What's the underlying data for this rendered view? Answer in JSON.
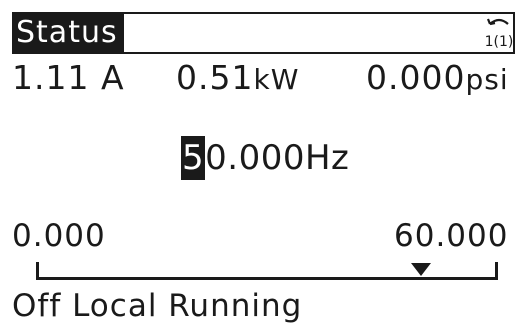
{
  "header": {
    "title": "Status",
    "icon": "menu-index-icon",
    "icon_text": "1(1)"
  },
  "readouts": [
    {
      "value": "1.11",
      "unit": "A"
    },
    {
      "value": "0.51",
      "unit": "kW"
    },
    {
      "value": "0.000",
      "unit": "psi"
    }
  ],
  "setpoint": {
    "cursor_digit": "5",
    "rest": "0.000",
    "unit": "Hz"
  },
  "range": {
    "min": "0.000",
    "max": "60.000",
    "current_fraction": 0.833
  },
  "status_line": "Off Local Running",
  "colors": {
    "foreground": "#1a1a1a",
    "background": "#ffffff"
  }
}
